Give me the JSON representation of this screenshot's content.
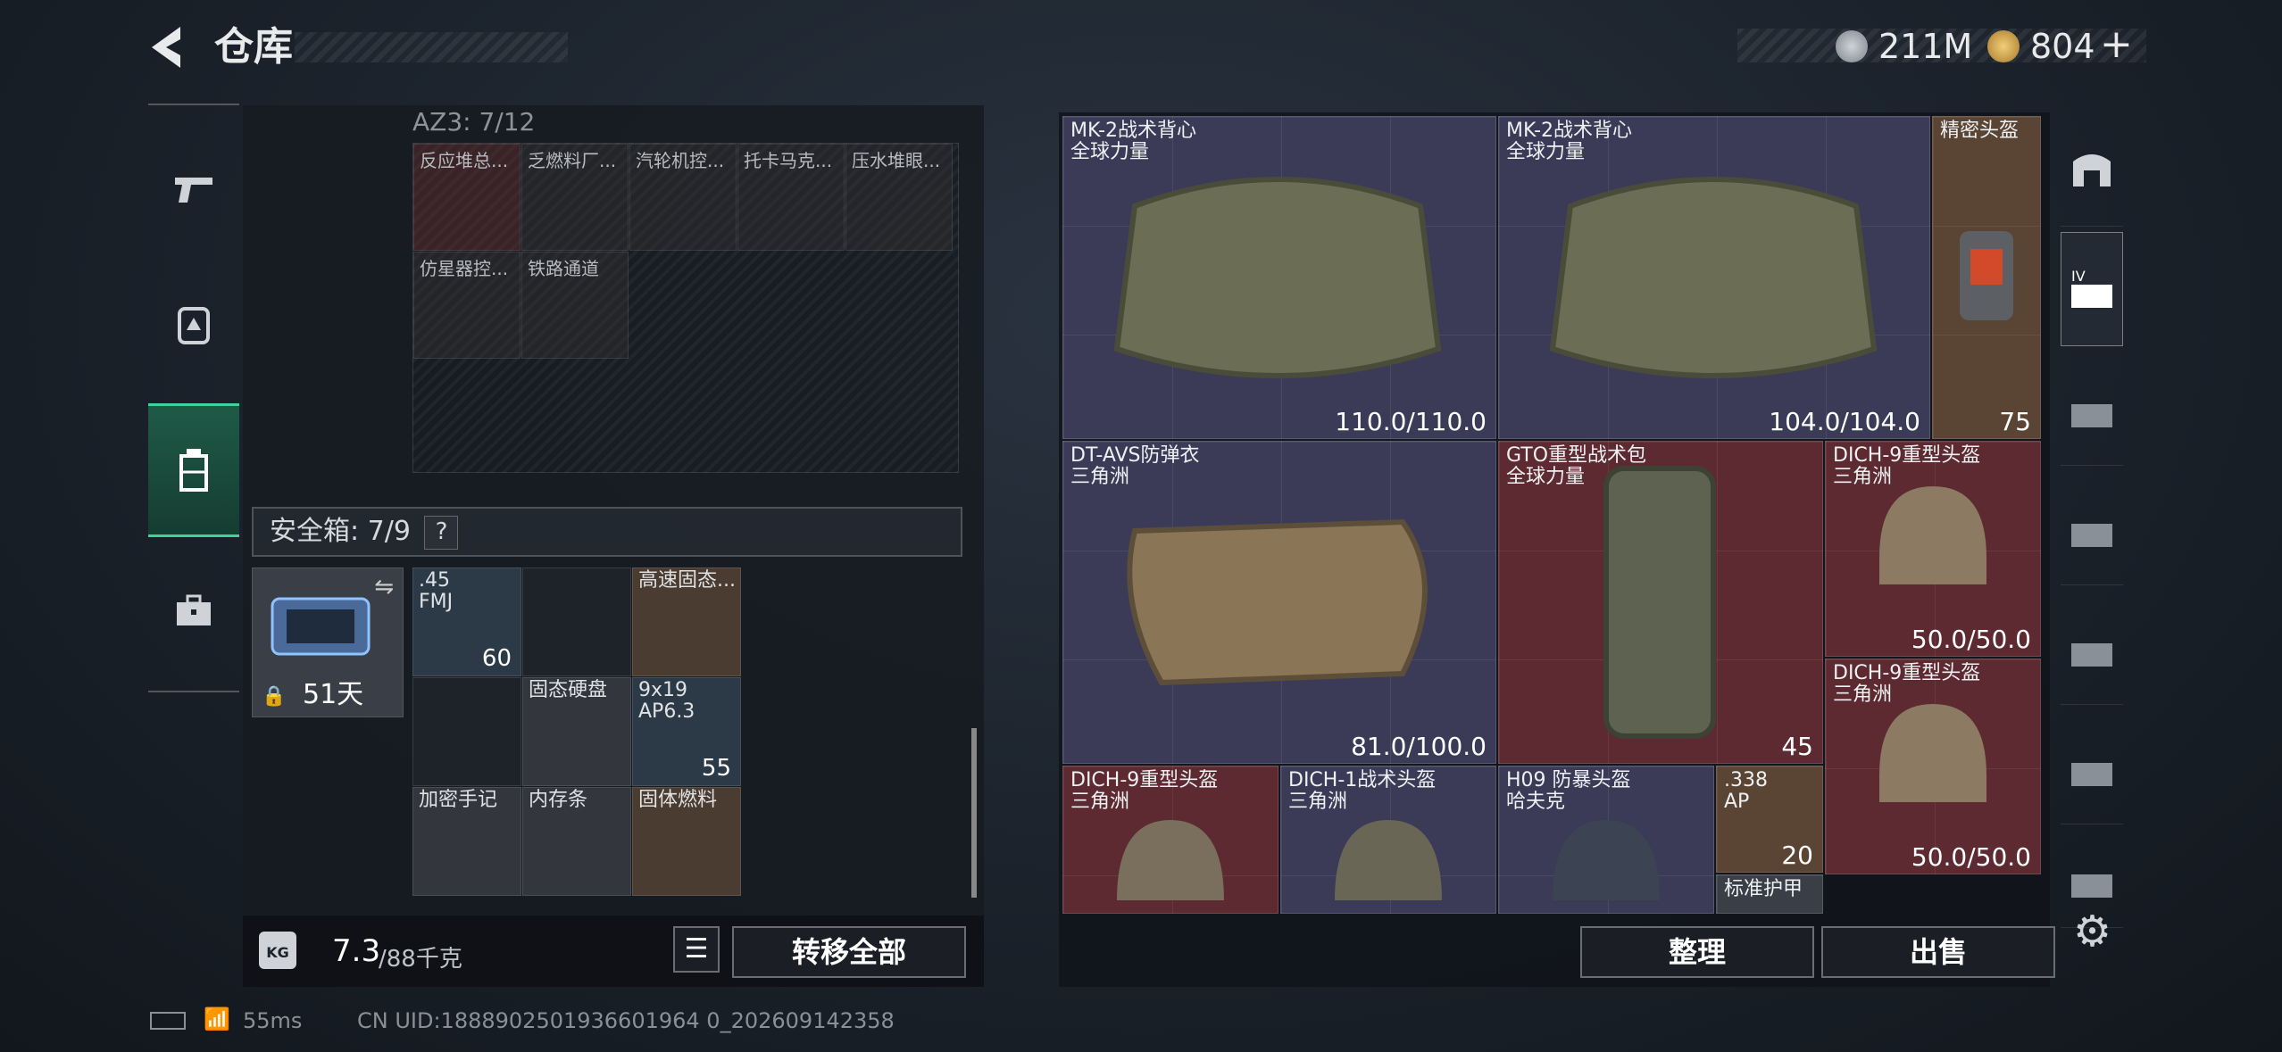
{
  "header": {
    "title": "仓库",
    "back_icon": "back-arrow-icon"
  },
  "currency": {
    "silver": "211M",
    "gold": "804",
    "add": "+"
  },
  "container": {
    "title": "AZ3: 7/12",
    "items": [
      "反应堆总...",
      "乏燃料厂...",
      "汽轮机控...",
      "托卡马克...",
      "压水堆眼...",
      "仿星器控...",
      "铁路通道"
    ]
  },
  "safe_box": {
    "label": "安全箱: 7/9",
    "help": "?",
    "days": "51天"
  },
  "safe_items": [
    {
      "name": ".45\nFMJ",
      "count": "60"
    },
    {
      "name": "高速固态...",
      "count": ""
    },
    {
      "name": "固态硬盘",
      "count": ""
    },
    {
      "name": "9x19\nAP6.3",
      "count": "55"
    },
    {
      "name": "加密手记",
      "count": ""
    },
    {
      "name": "内存条",
      "count": ""
    },
    {
      "name": "固体燃料",
      "count": ""
    }
  ],
  "weight": {
    "current": "7.3",
    "max": "/88千克"
  },
  "buttons": {
    "transfer_all": "转移全部",
    "sort": "整理",
    "sell": "出售"
  },
  "stash": [
    {
      "name": "MK-2战术背心\n全球力量",
      "value": "110.0/110.0"
    },
    {
      "name": "MK-2战术背心\n全球力量",
      "value": "104.0/104.0"
    },
    {
      "name": "精密头盔",
      "value": "75"
    },
    {
      "name": "DT-AVS防弹衣\n三角洲",
      "value": "81.0/100.0"
    },
    {
      "name": "GTO重型战术包\n全球力量",
      "value": "45"
    },
    {
      "name": "DICH-9重型头盔\n三角洲",
      "value": "50.0/50.0"
    },
    {
      "name": "DICH-9重型头盔\n三角洲",
      "value": "50.0/50.0"
    },
    {
      "name": "DICH-9重型头盔\n三角洲",
      "value": ""
    },
    {
      "name": "DICH-1战术头盔\n三角洲",
      "value": ""
    },
    {
      "name": "H09 防暴头盔\n哈夫克",
      "value": ""
    },
    {
      "name": ".338\nAP",
      "value": "20"
    },
    {
      "name": "标准护甲",
      "value": ""
    }
  ],
  "status": {
    "ping": "55ms",
    "uid": "CN UID:1888902501936601964 0_202609142358"
  }
}
